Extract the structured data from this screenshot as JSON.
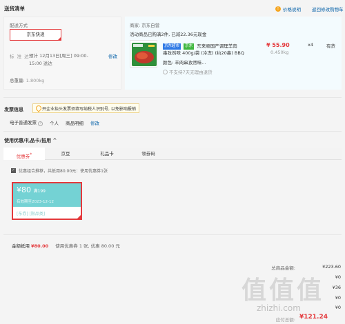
{
  "shipping": {
    "heading": "送货清单",
    "price_help": "价格说明",
    "back_cart": "返回修改购物车",
    "delivery_label": "配送方式",
    "delivery_method": "京东快递",
    "time_label": "标 准 达:",
    "time_value": "预计 12月13日[周三] 09:00-15:00 送达",
    "modify": "修改",
    "weight_label": "总重量:",
    "weight_value": "1.800kg"
  },
  "item": {
    "seller": "商家: 京东自营",
    "promo": "活动商品已购满2件, 已减22.36元现金",
    "tag1": "京东超市",
    "tag2": "京东",
    "title_line1": "东来顺国产调理羊肉",
    "title_line2": "串孜然味 400g/袋 (冷冻) (约20串) BBQ",
    "color": "颜色: 羊肉串孜然味...",
    "return_note": "不支持7天无理由退货",
    "price": "¥ 55.90",
    "unit_weight": "0.450kg",
    "qty": "x4",
    "stock": "有货"
  },
  "invoice": {
    "title": "发票信息",
    "tip": "开企业抬头发票须填写纳税人识别号, 以免影响报销",
    "type": "电子普通发票",
    "header": "个人",
    "content": "商品明细",
    "modify": "修改"
  },
  "coupons": {
    "title": "使用优惠/礼品卡/抵用 ^",
    "tabs": [
      "优惠券",
      "京豆",
      "礼品卡",
      "领劵码"
    ],
    "tab_mark": "*",
    "combo_text": "优惠组合推荐，共抵用80.00元：使用优惠券1张",
    "card_amount": "¥80",
    "card_condition": "满199",
    "card_validity": "有效期至2023-12-12",
    "card_tags": "[东券] [限品类]",
    "deduct_label": "金额抵用",
    "deduct_value": "¥80.00",
    "deduct_detail": "使用优惠券 1 张, 优惠 80.00 元"
  },
  "totals": {
    "goods_label": "总商品金额:",
    "goods_value": "¥223.60",
    "row2_value": "¥0",
    "row3_value": "¥36",
    "row4_value": "¥0",
    "row5_value": "¥0",
    "pay_label": "应付总额:",
    "pay_value": "¥121.24"
  },
  "watermark": {
    "big": "值值值",
    "small": "zhizhi.com"
  }
}
